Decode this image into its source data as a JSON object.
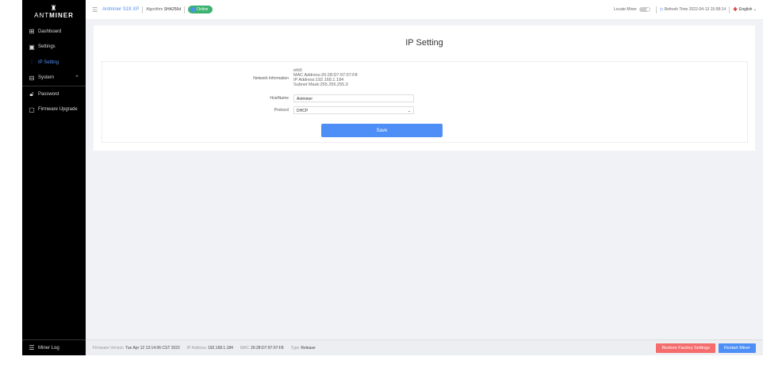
{
  "sidebar": {
    "logo": "ANTMINER",
    "items": [
      {
        "label": "Dashboard",
        "icon": "dashboard-icon"
      },
      {
        "label": "Settings",
        "icon": "settings-icon"
      },
      {
        "label": "IP Setting",
        "icon": "sliders-icon"
      },
      {
        "label": "System",
        "icon": "system-icon"
      },
      {
        "label": "Password",
        "icon": "lock-icon"
      },
      {
        "label": "Firmware Upgrade",
        "icon": "upgrade-icon"
      }
    ],
    "miner_log": "Miner Log"
  },
  "header": {
    "miner": "Antminer S19 XP",
    "algorithm_label": "Algorithm",
    "algorithm": "SHA256d",
    "status": "Online",
    "locate_label": "Locate Miner",
    "refresh_label": "Refresh Time",
    "refresh_time": "2022-04-13 15:58:14",
    "language": "English"
  },
  "page": {
    "title": "IP Setting",
    "network_label": "Network Information",
    "network": [
      "eth0",
      "MAC Address:26:28:D7:97:07:F8",
      "IP Address:192.168.1.184",
      "Subnet Mask:255.255.255.0"
    ],
    "hostname_label": "HostName",
    "hostname": "Antminer",
    "protocol_label": "Protocol",
    "protocol": "DHCP",
    "save": "Save"
  },
  "footer": {
    "fw_label": "Firmware Version",
    "fw": "Tue Apr 12 13:14:06 CST 2022",
    "ip_label": "IP Address",
    "ip": "192.168.1.184",
    "mac_label": "MAC",
    "mac": "26:28:D7:97:07:F8",
    "type_label": "Type",
    "type": "Release",
    "restore": "Restore Factory Settings",
    "restart": "Restart Miner"
  },
  "colors": {
    "accent": "#4e8ef7",
    "online": "#3cb371",
    "danger": "#f56c6c"
  }
}
